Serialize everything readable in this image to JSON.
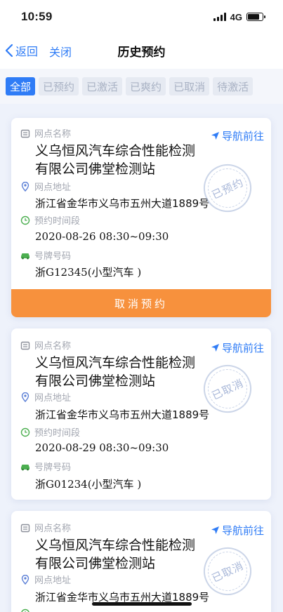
{
  "status_bar": {
    "time": "10:59",
    "network": "4G"
  },
  "nav": {
    "back_label": "返回",
    "close_label": "关闭",
    "title": "历史预约"
  },
  "tabs": [
    {
      "label": "全部",
      "active": true
    },
    {
      "label": "已预约",
      "active": false
    },
    {
      "label": "已激活",
      "active": false
    },
    {
      "label": "已爽约",
      "active": false
    },
    {
      "label": "已取消",
      "active": false
    },
    {
      "label": "待激活",
      "active": false
    }
  ],
  "field_labels": {
    "station_name": "网点名称",
    "station_address": "网点地址",
    "time_slot": "预约时间段",
    "plate_number": "号牌号码"
  },
  "navigate_label": "导航前往",
  "cards": [
    {
      "name_line1": "义乌恒风汽车综合性能检测",
      "name_line2": "有限公司佛堂检测站",
      "address": "浙江省金华市义乌市五州大道1889号",
      "time_slot": "2020-08-26 08:30~09:30",
      "plate": "浙G12345(小型汽车 )",
      "stamp": "已预约",
      "cancel_label": "取消预约"
    },
    {
      "name_line1": "义乌恒风汽车综合性能检测",
      "name_line2": "有限公司佛堂检测站",
      "address": "浙江省金华市义乌市五州大道1889号",
      "time_slot": "2020-08-29 08:30~09:30",
      "plate": "浙G01234(小型汽车 )",
      "stamp": "已取消"
    },
    {
      "name_line1": "义乌恒风汽车综合性能检测",
      "name_line2": "有限公司佛堂检测站",
      "address": "浙江省金华市义乌市五州大道1889号",
      "stamp": "已取消"
    }
  ],
  "colors": {
    "accent": "#2f7cf6",
    "cancel_button": "#f7913d",
    "label_gray": "#a2a6b0",
    "icon_green": "#4caf50"
  }
}
